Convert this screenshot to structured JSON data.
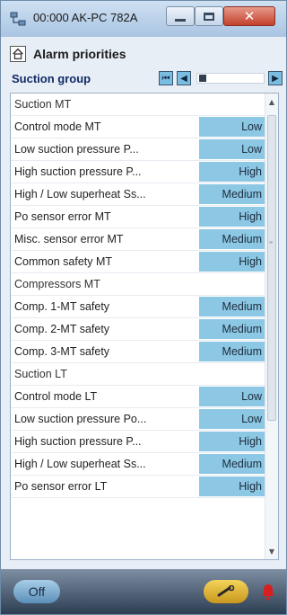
{
  "window": {
    "title": "00:000 AK-PC 782A"
  },
  "header": {
    "title": "Alarm priorities"
  },
  "group": {
    "label": "Suction group"
  },
  "rows": [
    {
      "label": "Suction MT",
      "value": null
    },
    {
      "label": "Control mode MT",
      "value": "Low"
    },
    {
      "label": "Low suction pressure P...",
      "value": "Low"
    },
    {
      "label": "High suction pressure P...",
      "value": "High"
    },
    {
      "label": "High / Low superheat Ss...",
      "value": "Medium"
    },
    {
      "label": "Po sensor error MT",
      "value": "High"
    },
    {
      "label": "Misc. sensor error MT",
      "value": "Medium"
    },
    {
      "label": "Common safety MT",
      "value": "High"
    },
    {
      "label": "Compressors MT",
      "value": null
    },
    {
      "label": "Comp. 1-MT safety",
      "value": "Medium"
    },
    {
      "label": "Comp. 2-MT safety",
      "value": "Medium"
    },
    {
      "label": "Comp. 3-MT safety",
      "value": "Medium"
    },
    {
      "label": "Suction LT",
      "value": null
    },
    {
      "label": "Control mode LT",
      "value": "Low"
    },
    {
      "label": "Low suction pressure Po...",
      "value": "Low"
    },
    {
      "label": "High suction pressure P...",
      "value": "High"
    },
    {
      "label": "High / Low superheat Ss...",
      "value": "Medium"
    },
    {
      "label": "Po sensor error LT",
      "value": "High"
    }
  ],
  "footer": {
    "off_label": "Off"
  },
  "colors": {
    "value_cell": "#8cc7e4",
    "group_label": "#102a63",
    "alarm_bell": "#d62020"
  }
}
